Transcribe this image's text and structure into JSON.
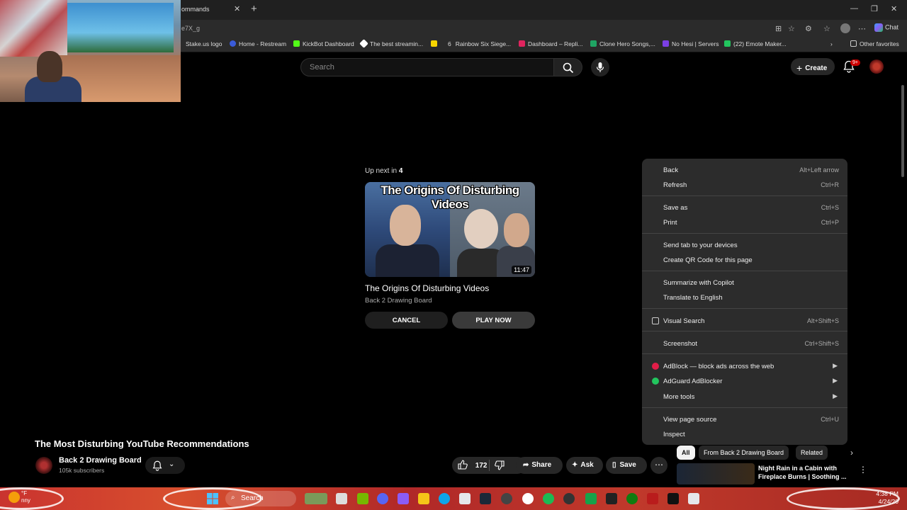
{
  "browser": {
    "tab_title": "ommands",
    "url_fragment": "e7X_g",
    "chat_label": "Chat",
    "bookmarks": [
      {
        "label": "Stake.us logo",
        "color": "#2b2b2b"
      },
      {
        "label": "Home - Restream",
        "color": "#3a5bd9"
      },
      {
        "label": "KickBot Dashboard",
        "color": "#53fc18"
      },
      {
        "label": "The best streamin...",
        "color": "#ffffff"
      },
      {
        "label": "6",
        "color": "#f7d500"
      },
      {
        "label": "Rainbow Six Siege...",
        "color": "#555555"
      },
      {
        "label": "Dashboard – Repli...",
        "color": "#e0245e"
      },
      {
        "label": "Clone Hero Songs,...",
        "color": "#1fa463"
      },
      {
        "label": "No Hesi | Servers",
        "color": "#7b3fe4"
      },
      {
        "label": "(22) Emote Maker...",
        "color": "#22c55e"
      }
    ],
    "other_favorites": "Other favorites"
  },
  "youtube": {
    "search_placeholder": "Search",
    "create_label": "Create",
    "notif_badge": "9+"
  },
  "upnext": {
    "prefix": "Up next in ",
    "countdown": "4",
    "thumb_caption": "The Origins Of Disturbing Videos",
    "duration": "11:47",
    "title": "The Origins Of Disturbing Videos",
    "channel": "Back 2 Drawing Board",
    "cancel_label": "CANCEL",
    "play_label": "PLAY NOW"
  },
  "context_menu": {
    "items": [
      {
        "label": "Back",
        "shortcut": "Alt+Left arrow"
      },
      {
        "label": "Refresh",
        "shortcut": "Ctrl+R"
      },
      {
        "label": "Save as",
        "shortcut": "Ctrl+S"
      },
      {
        "label": "Print",
        "shortcut": "Ctrl+P"
      },
      {
        "label": "Send tab to your devices",
        "shortcut": ""
      },
      {
        "label": "Create QR Code for this page",
        "shortcut": ""
      },
      {
        "label": "Summarize with Copilot",
        "shortcut": ""
      },
      {
        "label": "Translate to English",
        "shortcut": ""
      },
      {
        "label": "Visual Search",
        "shortcut": "Alt+Shift+S"
      },
      {
        "label": "Screenshot",
        "shortcut": "Ctrl+Shift+S"
      },
      {
        "label": "AdBlock — block ads across the web",
        "shortcut": ""
      },
      {
        "label": "AdGuard AdBlocker",
        "shortcut": ""
      },
      {
        "label": "More tools",
        "shortcut": ""
      },
      {
        "label": "View page source",
        "shortcut": "Ctrl+U"
      },
      {
        "label": "Inspect",
        "shortcut": ""
      }
    ]
  },
  "video": {
    "title": "The Most Disturbing YouTube Recommendations",
    "channel": "Back 2 Drawing Board",
    "subscribers": "105k subscribers",
    "likes": "172",
    "share_label": "Share",
    "ask_label": "Ask",
    "save_label": "Save"
  },
  "sidebar": {
    "chips": [
      "All",
      "From Back 2 Drawing Board",
      "Related"
    ],
    "rec_title": "Night Rain in a Cabin with Fireplace Burns | Soothing ..."
  },
  "taskbar": {
    "search_label": "Search",
    "weather_temp": "°F",
    "weather_desc": "nny",
    "time": "4:38 PM",
    "date": "4/24/20"
  }
}
